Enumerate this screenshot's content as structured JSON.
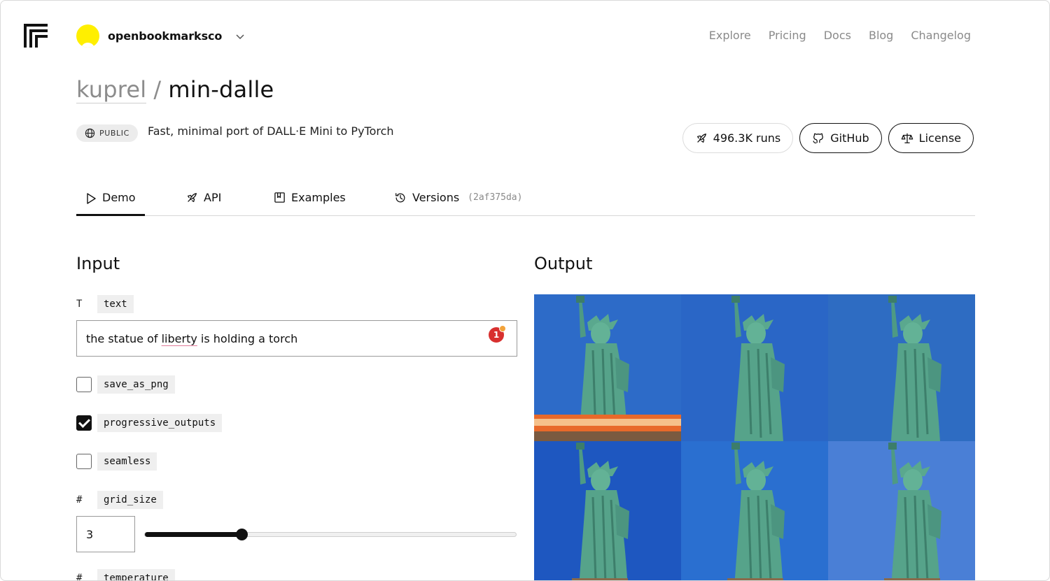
{
  "header": {
    "org_name": "openbookmarksco",
    "nav": [
      "Explore",
      "Pricing",
      "Docs",
      "Blog",
      "Changelog"
    ]
  },
  "model": {
    "owner": "kuprel",
    "separator": "/",
    "name": "min-dalle",
    "visibility": "PUBLIC",
    "description": "Fast, minimal port of DALL·E Mini to PyTorch"
  },
  "actions": {
    "runs": "496.3K runs",
    "github": "GitHub",
    "license": "License"
  },
  "tabs": {
    "demo": "Demo",
    "api": "API",
    "examples": "Examples",
    "versions": "Versions",
    "version_hash": "(2af375da)"
  },
  "input": {
    "title": "Input",
    "text": {
      "type_glyph": "T",
      "label": "text",
      "value_before": "the statue of ",
      "value_flagged": "liberty",
      "value_after": " is holding a torch",
      "grammar_count": "1"
    },
    "save_as_png": {
      "label": "save_as_png",
      "checked": false
    },
    "progressive_outputs": {
      "label": "progressive_outputs",
      "checked": true
    },
    "seamless": {
      "label": "seamless",
      "checked": false
    },
    "grid_size": {
      "type_glyph": "#",
      "label": "grid_size",
      "value": "3",
      "slider_fraction": 0.26
    },
    "temperature": {
      "type_glyph": "#",
      "label": "temperature"
    }
  },
  "output": {
    "title": "Output",
    "grid_rows": 2,
    "grid_cols": 3,
    "image_subject": "statue-of-liberty"
  },
  "colors": {
    "sky_blue": "#2f66c4",
    "statue_green": "#5fae95",
    "avatar_yellow": "#ffef00"
  }
}
